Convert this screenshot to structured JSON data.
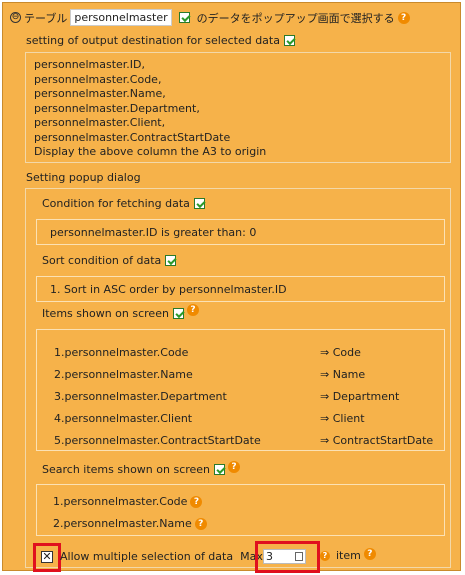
{
  "header": {
    "prefix": "テーブル",
    "table_name": "personnelmaster",
    "suffix": "のデータをポップアップ画面で選択する"
  },
  "output": {
    "title": "setting of output destination for selected data",
    "lines": [
      "personnelmaster.ID,",
      "personnelmaster.Code,",
      "personnelmaster.Name,",
      "personnelmaster.Department,",
      "personnelmaster.Client,",
      "personnelmaster.ContractStartDate",
      "Display the above column the A3 to origin"
    ]
  },
  "popup": {
    "title": "Setting popup dialog",
    "fetch_title": "Condition for fetching data",
    "fetch_condition": "personnelmaster.ID is greater than: 0",
    "sort_title": "Sort condition of data",
    "sort_condition": "1. Sort in ASC order by personnelmaster.ID",
    "items_title": "Items shown on screen",
    "items": [
      {
        "left": "1.personnelmaster.Code",
        "right": "⇒ Code"
      },
      {
        "left": "2.personnelmaster.Name",
        "right": "⇒ Name"
      },
      {
        "left": "3.personnelmaster.Department",
        "right": "⇒ Department"
      },
      {
        "left": "4.personnelmaster.Client",
        "right": "⇒ Client"
      },
      {
        "left": "5.personnelmaster.ContractStartDate",
        "right": "⇒ ContractStartDate"
      }
    ],
    "search_title": "Search items shown on screen",
    "search_items": [
      "1.personnelmaster.Code",
      "2.personnelmaster.Name"
    ]
  },
  "footer": {
    "checkbox_checked": true,
    "checkbox_mark": "✕",
    "allow_label": "Allow multiple selection of data",
    "max_label": "Max",
    "max_value": "3",
    "item_label": "item"
  },
  "icons": {
    "collapse": "⊖",
    "help": "?"
  },
  "colors": {
    "panel": "#f6b24a",
    "highlight": "#e0101e",
    "help": "#f08a00"
  }
}
